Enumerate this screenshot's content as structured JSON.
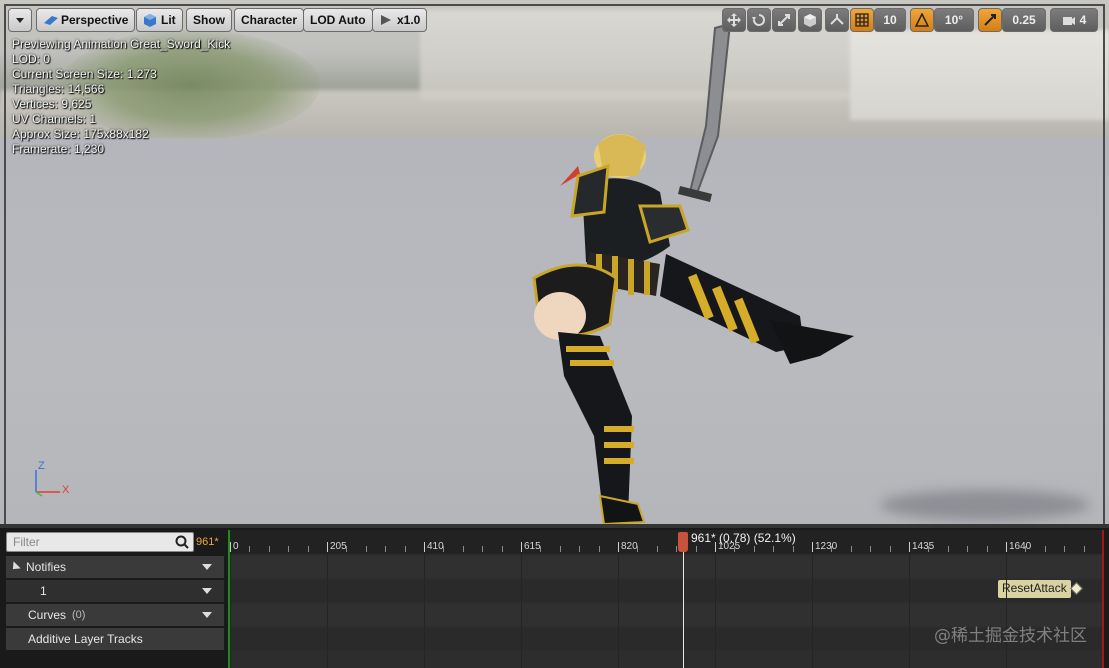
{
  "viewport": {
    "toolbar": {
      "perspective_label": "Perspective",
      "lit_label": "Lit",
      "show_label": "Show",
      "character_label": "Character",
      "lod_label": "LOD Auto",
      "speed_label": "x1.0",
      "grid_snap_value": "10",
      "rotation_snap_value": "10°",
      "scale_snap_value": "0.25",
      "camera_speed_value": "4"
    },
    "stats": [
      "Previewing Animation Great_Sword_Kick",
      "LOD: 0",
      "Current Screen Size: 1.273",
      "Triangles: 14,566",
      "Vertices: 9,625",
      "UV Channels: 1",
      "Approx Size: 175x88x182",
      "Framerate: 1,230"
    ],
    "axis": {
      "z": "Z",
      "x": "X"
    }
  },
  "timeline": {
    "filter_placeholder": "Filter",
    "current_frame_label": "961*",
    "tracks": {
      "notifies_label": "Notifies",
      "notify_track_1": "1",
      "curves_label": "Curves",
      "curves_count": "(0)",
      "additive_label": "Additive Layer Tracks"
    },
    "ruler_labels": [
      "0",
      "205",
      "410",
      "615",
      "820",
      "1025",
      "1230",
      "1435",
      "1640"
    ],
    "playhead_label": "961* (0.78) (52.1%)",
    "notify_event_label": "ResetAttack"
  },
  "watermark": "@稀土掘金技术社区",
  "colors": {
    "accent_orange": "#d47e13",
    "playhead": "#c9533a",
    "notify_bg": "#d9d3a2"
  }
}
